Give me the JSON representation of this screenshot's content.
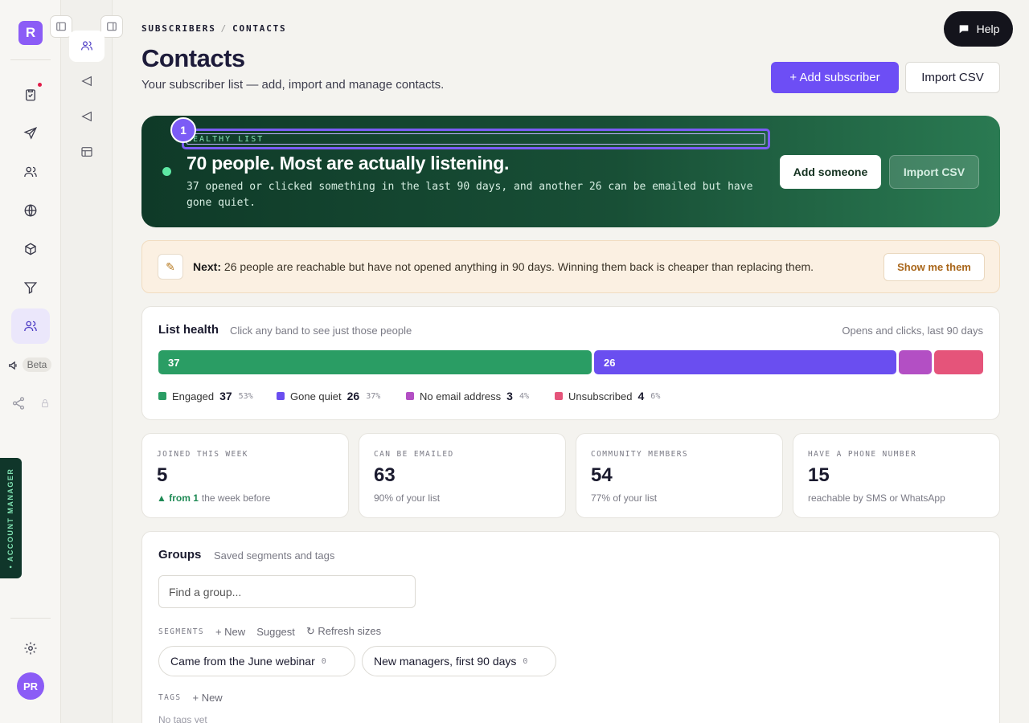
{
  "app": {
    "logo_letter": "R",
    "user_initials": "PR",
    "beta_label": "Beta",
    "account_manager_label": "• ACCOUNT MANAGER"
  },
  "rail_icons": [
    "clipboard-check-icon",
    "send-icon",
    "users-icon",
    "globe-icon",
    "box-icon",
    "filter-icon",
    "contacts-icon",
    "megaphone-icon",
    "share-icon",
    "lock-icon",
    "gear-icon"
  ],
  "help": {
    "label": "Help"
  },
  "breadcrumb": {
    "parent": "SUBSCRIBERS",
    "separator": "/",
    "current": "CONTACTS"
  },
  "header": {
    "title": "Contacts",
    "subtitle": "Your subscriber list — add, import and manage contacts.",
    "add_button": "+ Add subscriber",
    "import_button": "Import CSV"
  },
  "hero": {
    "step": "1",
    "kicker": "HEALTHY LIST",
    "title": "70 people. Most are actually listening.",
    "body": "37 opened or clicked something in the last 90 days, and another 26 can be emailed but have gone quiet.",
    "add_button": "Add someone",
    "import_button": "Import CSV"
  },
  "next": {
    "label": "Next:",
    "text": "26 people are reachable but have not opened anything in 90 days. Winning them back is cheaper than replacing them.",
    "button": "Show me them",
    "icon": "pencil-icon"
  },
  "list_health": {
    "title": "List health",
    "subtitle": "Click any band to see just those people",
    "period": "Opens and clicks, last 90 days",
    "bands": [
      {
        "label": "Engaged",
        "count": "37",
        "pct": "53%",
        "color": "#2a9d64",
        "share": 0.53,
        "bar_label": "37"
      },
      {
        "label": "Gone quiet",
        "count": "26",
        "pct": "37%",
        "color": "#6a4ef0",
        "share": 0.37,
        "bar_label": "26"
      },
      {
        "label": "No email address",
        "count": "3",
        "pct": "4%",
        "color": "#b34fc4",
        "share": 0.04,
        "bar_label": ""
      },
      {
        "label": "Unsubscribed",
        "count": "4",
        "pct": "6%",
        "color": "#e5547a",
        "share": 0.06,
        "bar_label": ""
      }
    ]
  },
  "stats": [
    {
      "label": "JOINED THIS WEEK",
      "value": "5",
      "up": "▲ from 1",
      "note": "the week before"
    },
    {
      "label": "CAN BE EMAILED",
      "value": "63",
      "up": "",
      "note": "90% of your list"
    },
    {
      "label": "COMMUNITY MEMBERS",
      "value": "54",
      "up": "",
      "note": "77% of your list"
    },
    {
      "label": "HAVE A PHONE NUMBER",
      "value": "15",
      "up": "",
      "note": "reachable by SMS or WhatsApp"
    }
  ],
  "groups": {
    "title": "Groups",
    "subtitle": "Saved segments and tags",
    "search_placeholder": "Find a group...",
    "segments_label": "SEGMENTS",
    "new_label": "+ New",
    "suggest_label": "Suggest",
    "refresh_label": "↻ Refresh sizes",
    "segments": [
      {
        "name": "Came from the June webinar",
        "count": "0"
      },
      {
        "name": "New managers, first 90 days",
        "count": "0"
      }
    ],
    "tags_label": "TAGS",
    "tags_new_label": "+ New",
    "tags_empty": "No tags yet"
  }
}
